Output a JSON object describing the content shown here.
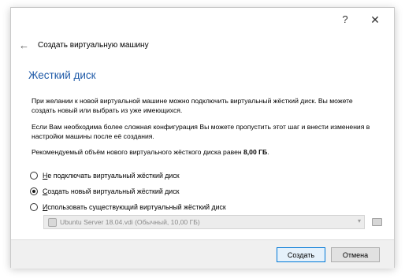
{
  "titlebar": {
    "help_label": "?",
    "close_label": "✕"
  },
  "nav": {
    "back_glyph": "←",
    "title": "Создать виртуальную машину"
  },
  "page": {
    "heading": "Жесткий диск",
    "paragraph1": "При желании к новой виртуальной машине можно подключить виртуальный жёсткий диск. Вы можете создать новый или выбрать из уже имеющихся.",
    "paragraph2": "Если Вам необходима более сложная конфигурация Вы можете пропустить этот шаг и внести изменения в настройки машины после её создания.",
    "paragraph3_prefix": "Рекомендуемый объём нового виртуального жёсткого диска равен ",
    "paragraph3_size": "8,00 ГБ",
    "paragraph3_suffix": "."
  },
  "options": {
    "no_disk": {
      "mnemonic": "Н",
      "rest": "е подключать виртуальный жёсткий диск",
      "selected": false
    },
    "create_new": {
      "mnemonic": "С",
      "rest": "оздать новый виртуальный жёсткий диск",
      "selected": true
    },
    "use_existing": {
      "mnemonic": "И",
      "rest": "спользовать существующий виртуальный жёсткий диск",
      "selected": false
    }
  },
  "disk_select": {
    "value": "Ubuntu Server 18.04.vdi (Обычный, 10,00 ГБ)",
    "enabled": false,
    "arrow_glyph": "▾"
  },
  "footer": {
    "create_label": "Создать",
    "cancel_label": "Отмена"
  },
  "icons": {
    "back": "back-arrow-icon",
    "disk": "hard-disk-icon",
    "folder": "folder-open-icon",
    "help": "help-icon",
    "close": "close-icon"
  },
  "colors": {
    "heading": "#1f5aa8",
    "default_button_border": "#0078d7",
    "footer_bg": "#f0f0f0"
  }
}
